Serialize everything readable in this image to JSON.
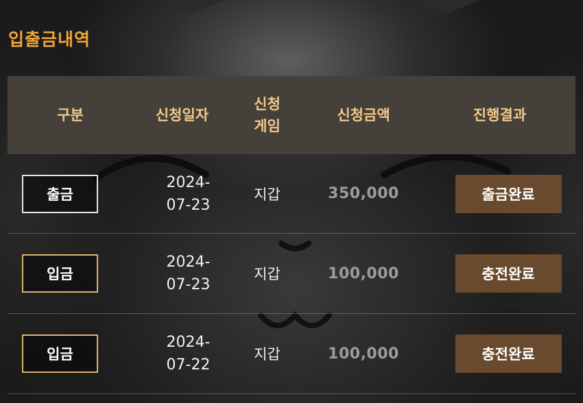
{
  "page": {
    "title": "입출금내역"
  },
  "table": {
    "headers": [
      "구분",
      "신청일자",
      "신청\n게임",
      "신청금액",
      "진행결과"
    ],
    "rows": [
      {
        "type": "출금",
        "type_kind": "out",
        "date": "2024-\n07-23",
        "game": "지갑",
        "amount": "350,000",
        "result": "출금완료"
      },
      {
        "type": "입금",
        "type_kind": "in",
        "date": "2024-\n07-23",
        "game": "지갑",
        "amount": "100,000",
        "result": "충전완료"
      },
      {
        "type": "입금",
        "type_kind": "in",
        "date": "2024-\n07-22",
        "game": "지갑",
        "amount": "100,000",
        "result": "충전완료"
      }
    ]
  },
  "colors": {
    "title": "#f0a43a",
    "header_bg": "#46403a",
    "header_text": "#f1c98a",
    "result_button": "#6a4a2e",
    "amount_text": "#9c9c9c",
    "deposit_border": "#e2b26e",
    "withdraw_border": "#e9e9e9"
  }
}
